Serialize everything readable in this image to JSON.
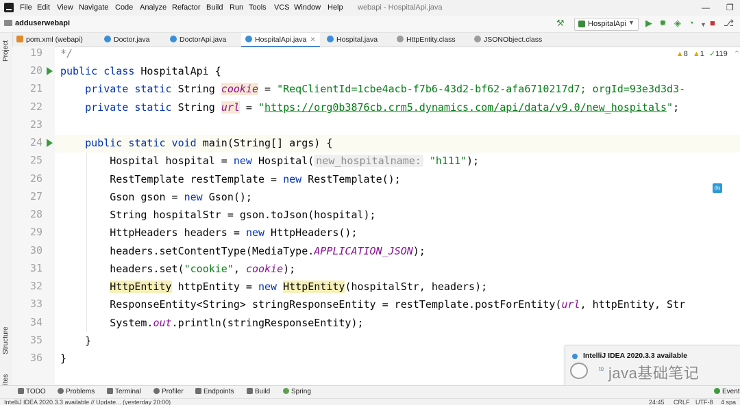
{
  "menubar": {
    "items": [
      "File",
      "Edit",
      "View",
      "Navigate",
      "Code",
      "Analyze",
      "Refactor",
      "Build",
      "Run",
      "Tools",
      "VCS",
      "Window",
      "Help"
    ],
    "window_title": "webapi - HospitalApi.java"
  },
  "navbar": {
    "project": "adduserwebapi",
    "run_config": "HospitalApi"
  },
  "tabs": [
    {
      "label": "pom.xml (webapi)",
      "kind": "xml"
    },
    {
      "label": "Doctor.java",
      "kind": "java"
    },
    {
      "label": "DoctorApi.java",
      "kind": "java"
    },
    {
      "label": "HospitalApi.java",
      "kind": "java",
      "active": true
    },
    {
      "label": "Hospital.java",
      "kind": "java"
    },
    {
      "label": "HttpEntity.class",
      "kind": "class"
    },
    {
      "label": "JSONObject.class",
      "kind": "class"
    }
  ],
  "left_tools": [
    "Project",
    "Structure",
    "Favorites"
  ],
  "inspections": {
    "warnings": "8",
    "weak": "1",
    "ok": "119"
  },
  "editor": {
    "line_numbers": [
      "19",
      "20",
      "21",
      "22",
      "23",
      "24",
      "25",
      "26",
      "27",
      "28",
      "29",
      "30",
      "31",
      "32",
      "33",
      "34",
      "35",
      "36"
    ],
    "tokens": {
      "l19": "*/",
      "l20_kw": "public class",
      "l20_rest": " HospitalApi {",
      "l21_kw": "private static",
      "l21_type": " String ",
      "l21_field": "cookie",
      "l21_eq": " = ",
      "l21_str": "\"ReqClientId=1cbe4acb-f7b6-43d2-bf62-afa6710217d7; orgId=93e3d3d3-",
      "l22_kw": "private static",
      "l22_type": " String ",
      "l22_field": "url",
      "l22_eq": " = ",
      "l22_q1": "\"",
      "l22_url": "https://org0b3876cb.crm5.dynamics.com/api/data/v9.0/new_hospitals",
      "l22_q2": "\"",
      "l22_end": ";",
      "l24_kw": "public static void",
      "l24_rest": " main(String[] args) {",
      "l25_a": "Hospital hospital = ",
      "l25_new": "new",
      "l25_b": " Hospital(",
      "l25_hint": "new_hospitalname:",
      "l25_str": " \"h111\"",
      "l25_c": ");",
      "l26_a": "RestTemplate restTemplate = ",
      "l26_new": "new",
      "l26_b": " RestTemplate();",
      "l27_a": "Gson gson = ",
      "l27_new": "new",
      "l27_b": " Gson();",
      "l28": "String hospitalStr = gson.toJson(hospital);",
      "l29_a": "HttpHeaders headers = ",
      "l29_new": "new",
      "l29_b": " HttpHeaders();",
      "l30_a": "headers.setContentType(MediaType.",
      "l30_field": "APPLICATION_JSON",
      "l30_b": ");",
      "l31_a": "headers.set(",
      "l31_str": "\"cookie\"",
      "l31_b": ", ",
      "l31_field": "cookie",
      "l31_c": ");",
      "l32_type": "HttpEntity",
      "l32_a": " httpEntity = ",
      "l32_new": "new",
      "l32_b": " ",
      "l32_type2": "HttpEntity",
      "l32_c": "(hospitalStr, headers);",
      "l33_a": "ResponseEntity<String> stringResponseEntity = restTemplate.postForEntity(",
      "l33_field": "url",
      "l33_b": ", httpEntity, Str",
      "l34_a": "System.",
      "l34_field": "out",
      "l34_b": ".println(stringResponseEntity);",
      "l35": "}",
      "l36": "}"
    }
  },
  "plugin_badge": "du",
  "notification": {
    "title": "IntelliJ IDEA 2020.3.3 available"
  },
  "watermark": {
    "text": "java基础笔记",
    "sub": "te"
  },
  "bottom_tools": [
    "TODO",
    "Problems",
    "Terminal",
    "Profiler",
    "Endpoints",
    "Build",
    "Spring"
  ],
  "event_log": "Event",
  "status": {
    "message": "IntelliJ IDEA 2020.3.3 available // Update... (yesterday 20:00)",
    "position": "24:45",
    "line_sep": "CRLF",
    "encoding": "UTF-8",
    "indent": "4 spa"
  }
}
